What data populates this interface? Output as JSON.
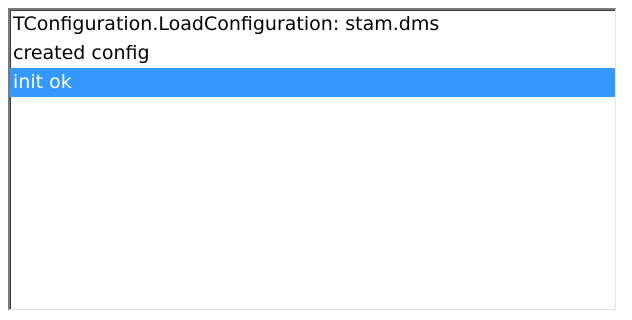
{
  "log_list": {
    "items": [
      {
        "text": "TConfiguration.LoadConfiguration: stam.dms",
        "selected": false
      },
      {
        "text": "created config",
        "selected": false
      },
      {
        "text": "init ok",
        "selected": true
      }
    ],
    "colors": {
      "selection_bg": "#3399ff",
      "selection_fg": "#ffffff"
    }
  }
}
